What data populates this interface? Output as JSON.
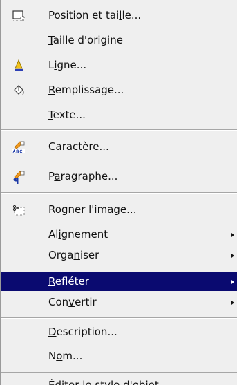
{
  "menu": {
    "items": [
      {
        "before": "Position et tai",
        "mn": "l",
        "after": "le...",
        "icon": "position-size-icon"
      },
      {
        "before": "",
        "mn": "T",
        "after": "aille d'origine",
        "icon": ""
      },
      {
        "before": "L",
        "mn": "i",
        "after": "gne...",
        "icon": "line-icon"
      },
      {
        "before": "",
        "mn": "R",
        "after": "emplissage...",
        "icon": "fill-bucket-icon"
      },
      {
        "before": "",
        "mn": "T",
        "after": "exte...",
        "icon": ""
      },
      {
        "before": "C",
        "mn": "a",
        "after": "ractère...",
        "icon": "character-icon"
      },
      {
        "before": "P",
        "mn": "a",
        "after": "ragraphe...",
        "icon": "paragraph-icon"
      },
      {
        "before": "Ro",
        "mn": "g",
        "after": "ner l'image...",
        "icon": "crop-icon"
      },
      {
        "before": "Al",
        "mn": "i",
        "after": "gnement",
        "icon": "",
        "submenu": true
      },
      {
        "before": "Orga",
        "mn": "n",
        "after": "iser",
        "icon": "",
        "submenu": true
      },
      {
        "before": "",
        "mn": "R",
        "after": "efléter",
        "icon": "",
        "submenu": true,
        "highlighted": true
      },
      {
        "before": "Con",
        "mn": "v",
        "after": "ertir",
        "icon": "",
        "submenu": true
      },
      {
        "before": "",
        "mn": "D",
        "after": "escription...",
        "icon": ""
      },
      {
        "before": "N",
        "mn": "o",
        "after": "m...",
        "icon": ""
      },
      {
        "before": "Éditer le style d'objet",
        "mn": "",
        "after": "",
        "icon": ""
      }
    ]
  },
  "colors": {
    "menu_background": "#efefef",
    "highlight_background": "#0a0a70",
    "highlight_text": "#ffffff",
    "text": "#111111"
  }
}
